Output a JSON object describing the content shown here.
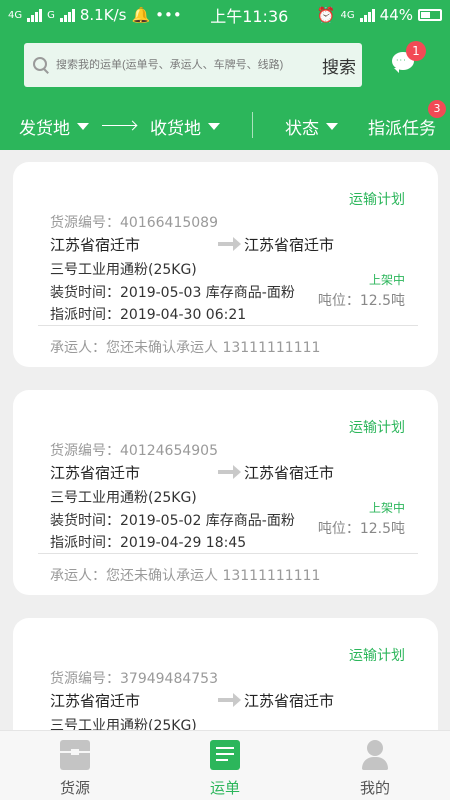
{
  "status_bar": {
    "network_left": "4G",
    "network_mid": "G",
    "speed": "8.1K/s",
    "more": "•••",
    "time": "上午11:36",
    "network_right": "4G",
    "battery": "44%"
  },
  "search": {
    "placeholder": "搜索我的运单(运单号、承运人、车牌号、线路)",
    "button_label": "搜索"
  },
  "messages": {
    "badge": "1"
  },
  "filters": {
    "from_label": "发货地",
    "to_label": "收货地",
    "status_label": "状态",
    "task_label": "指派任务",
    "task_badge": "3"
  },
  "waybills": [
    {
      "plan_label": "运输计划",
      "source_no": "货源编号：40166415089",
      "from_city": "江苏省宿迁市",
      "to_city": "江苏省宿迁市",
      "goods": "三号工业用通粉(25KG)",
      "status": "上架中",
      "load_time": "装货时间：2019-05-03 库存商品-面粉",
      "tonnage": "吨位：12.5吨",
      "assign_time": "指派时间：2019-04-30 06:21",
      "carrier": "承运人：您还未确认承运人   13111111111"
    },
    {
      "plan_label": "运输计划",
      "source_no": "货源编号：40124654905",
      "from_city": "江苏省宿迁市",
      "to_city": "江苏省宿迁市",
      "goods": "三号工业用通粉(25KG)",
      "status": "上架中",
      "load_time": "装货时间：2019-05-02 库存商品-面粉",
      "tonnage": "吨位：12.5吨",
      "assign_time": "指派时间：2019-04-29 18:45",
      "carrier": "承运人：您还未确认承运人   13111111111"
    },
    {
      "plan_label": "运输计划",
      "source_no": "货源编号：37949484753",
      "from_city": "江苏省宿迁市",
      "to_city": "江苏省宿迁市",
      "goods": "三号工业用通粉(25KG)"
    }
  ],
  "tabbar": {
    "tabs": [
      {
        "label": "货源",
        "icon": "cargo-box-icon",
        "active": false
      },
      {
        "label": "运单",
        "icon": "waybill-icon",
        "active": true
      },
      {
        "label": "我的",
        "icon": "user-icon",
        "active": false
      }
    ]
  },
  "colors": {
    "brand": "#2cb65b",
    "badge": "#f24a55",
    "background": "#efefef"
  }
}
